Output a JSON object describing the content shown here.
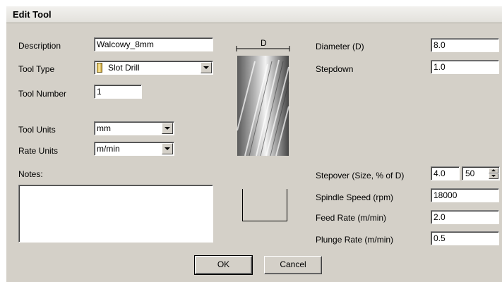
{
  "window": {
    "title": "Edit Tool"
  },
  "left": {
    "description_label": "Description",
    "description_value": "Walcowy_8mm",
    "tool_type_label": "Tool Type",
    "tool_type_value": "Slot Drill",
    "tool_number_label": "Tool Number",
    "tool_number_value": "1",
    "tool_units_label": "Tool Units",
    "tool_units_value": "mm",
    "rate_units_label": "Rate Units",
    "rate_units_value": "m/min",
    "notes_label": "Notes:",
    "notes_value": ""
  },
  "preview": {
    "diameter_marker": "D"
  },
  "right": {
    "diameter_label": "Diameter (D)",
    "diameter_value": "8.0",
    "stepdown_label": "Stepdown",
    "stepdown_value": "1.0",
    "stepover_label": "Stepover (Size, % of D)",
    "stepover_size_value": "4.0",
    "stepover_percent_value": "50",
    "spindle_speed_label": "Spindle Speed (rpm)",
    "spindle_speed_value": "18000",
    "feed_rate_label": "Feed Rate (m/min)",
    "feed_rate_value": "2.0",
    "plunge_rate_label": "Plunge Rate (m/min)",
    "plunge_rate_value": "0.5"
  },
  "buttons": {
    "ok_label": "OK",
    "cancel_label": "Cancel"
  },
  "icons": {
    "tool_type": "slot-drill-icon",
    "dropdown": "chevron-down-icon"
  },
  "colors": {
    "dialog_bg": "#d4d0c8",
    "field_bg": "#ffffff"
  }
}
